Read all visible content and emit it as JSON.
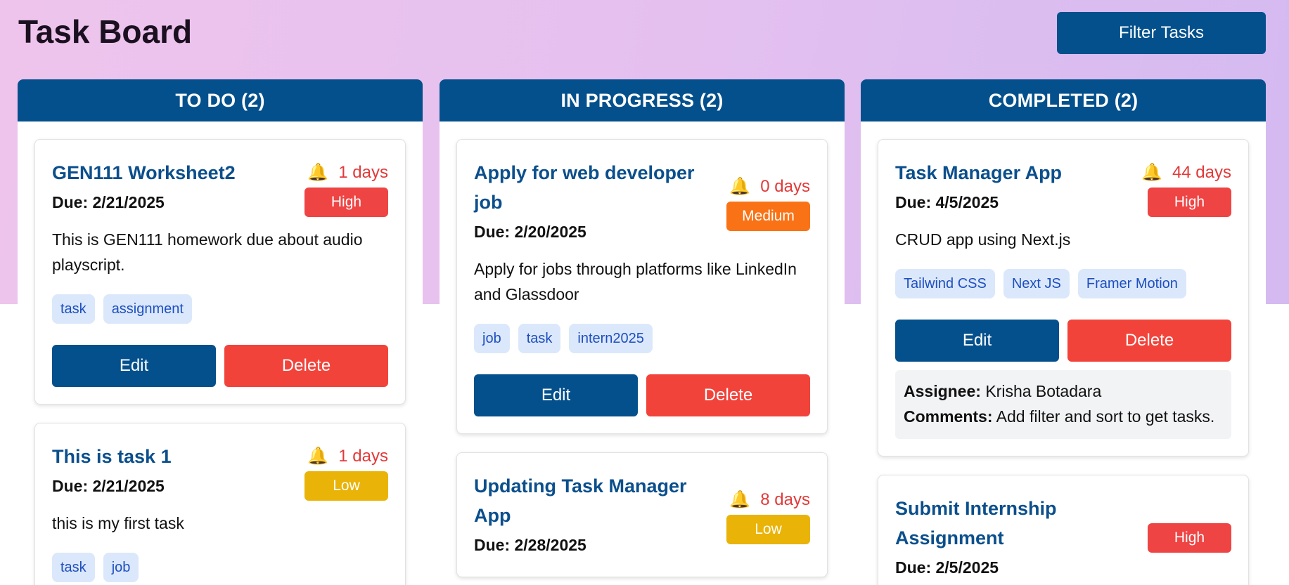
{
  "header": {
    "title": "Task Board",
    "filter_label": "Filter Tasks"
  },
  "colors": {
    "primary": "#03508c",
    "danger": "#f2433b",
    "high": "#ef4444",
    "medium": "#f97316",
    "low": "#eab308",
    "tag_bg": "#dbe8fb",
    "tag_text": "#1e4fbf"
  },
  "icons": {
    "bell": "bell-icon"
  },
  "columns": [
    {
      "title": "TO DO (2)",
      "cards": [
        {
          "title": "GEN111 Worksheet2",
          "days": "1 days",
          "due": "Due: 2/21/2025",
          "priority": "High",
          "description": "This is GEN111 homework due about audio playscript.",
          "tags": [
            "task",
            "assignment"
          ],
          "edit_label": "Edit",
          "delete_label": "Delete"
        },
        {
          "title": "This is task 1",
          "days": "1 days",
          "due": "Due: 2/21/2025",
          "priority": "Low",
          "description": "this is my first task",
          "tags": [
            "task",
            "job"
          ]
        }
      ]
    },
    {
      "title": "IN PROGRESS (2)",
      "cards": [
        {
          "title": "Apply for web developer job",
          "days": "0 days",
          "due": "Due: 2/20/2025",
          "priority": "Medium",
          "description": "Apply for jobs through platforms like LinkedIn and Glassdoor",
          "tags": [
            "job",
            "task",
            "intern2025"
          ],
          "edit_label": "Edit",
          "delete_label": "Delete"
        },
        {
          "title": "Updating Task Manager App",
          "days": "8 days",
          "due": "Due: 2/28/2025",
          "priority": "Low"
        }
      ]
    },
    {
      "title": "COMPLETED (2)",
      "cards": [
        {
          "title": "Task Manager App",
          "days": "44 days",
          "due": "Due: 4/5/2025",
          "priority": "High",
          "description": "CRUD app using Next.js",
          "tags": [
            "Tailwind CSS",
            "Next JS",
            "Framer Motion"
          ],
          "edit_label": "Edit",
          "delete_label": "Delete",
          "assignee_label": "Assignee:",
          "assignee": "Krisha Botadara",
          "comments_label": "Comments:",
          "comments": "Add filter and sort to get tasks."
        },
        {
          "title": "Submit Internship Assignment",
          "due": "Due: 2/5/2025",
          "priority": "High"
        }
      ]
    }
  ]
}
